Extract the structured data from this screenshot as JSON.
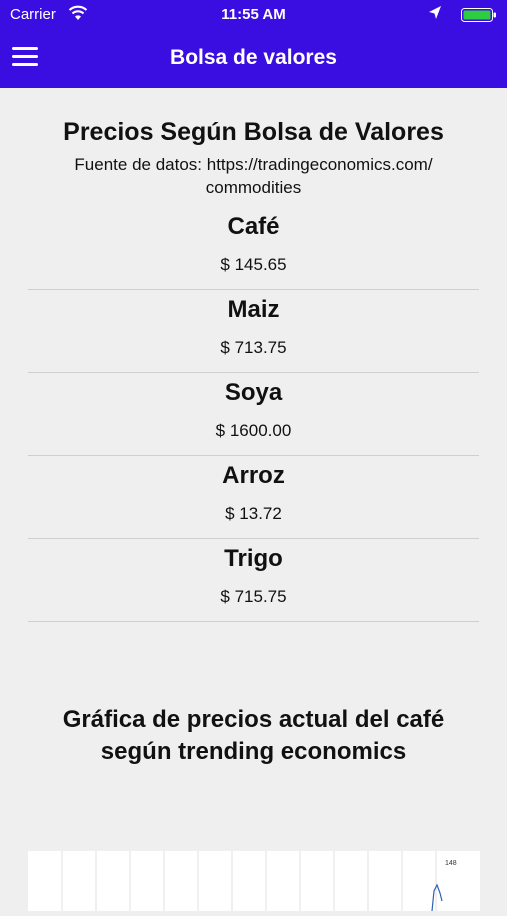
{
  "status_bar": {
    "carrier": "Carrier",
    "time": "11:55 AM"
  },
  "nav": {
    "title": "Bolsa de valores"
  },
  "heading": "Precios Según Bolsa de Valores",
  "source": "Fuente de datos: https://tradingeconomics.com/ commodities",
  "items": [
    {
      "name": "Café",
      "price": "$ 145.65"
    },
    {
      "name": "Maiz",
      "price": "$ 713.75"
    },
    {
      "name": "Soya",
      "price": "$ 1600.00"
    },
    {
      "name": "Arroz",
      "price": "$ 13.72"
    },
    {
      "name": "Trigo",
      "price": "$ 715.75"
    }
  ],
  "chart_section": {
    "title": "Gráfica de precios actual del café según trending economics",
    "tick_label": "148"
  },
  "colors": {
    "accent": "#3a0ee0",
    "battery": "#2ecc40"
  }
}
